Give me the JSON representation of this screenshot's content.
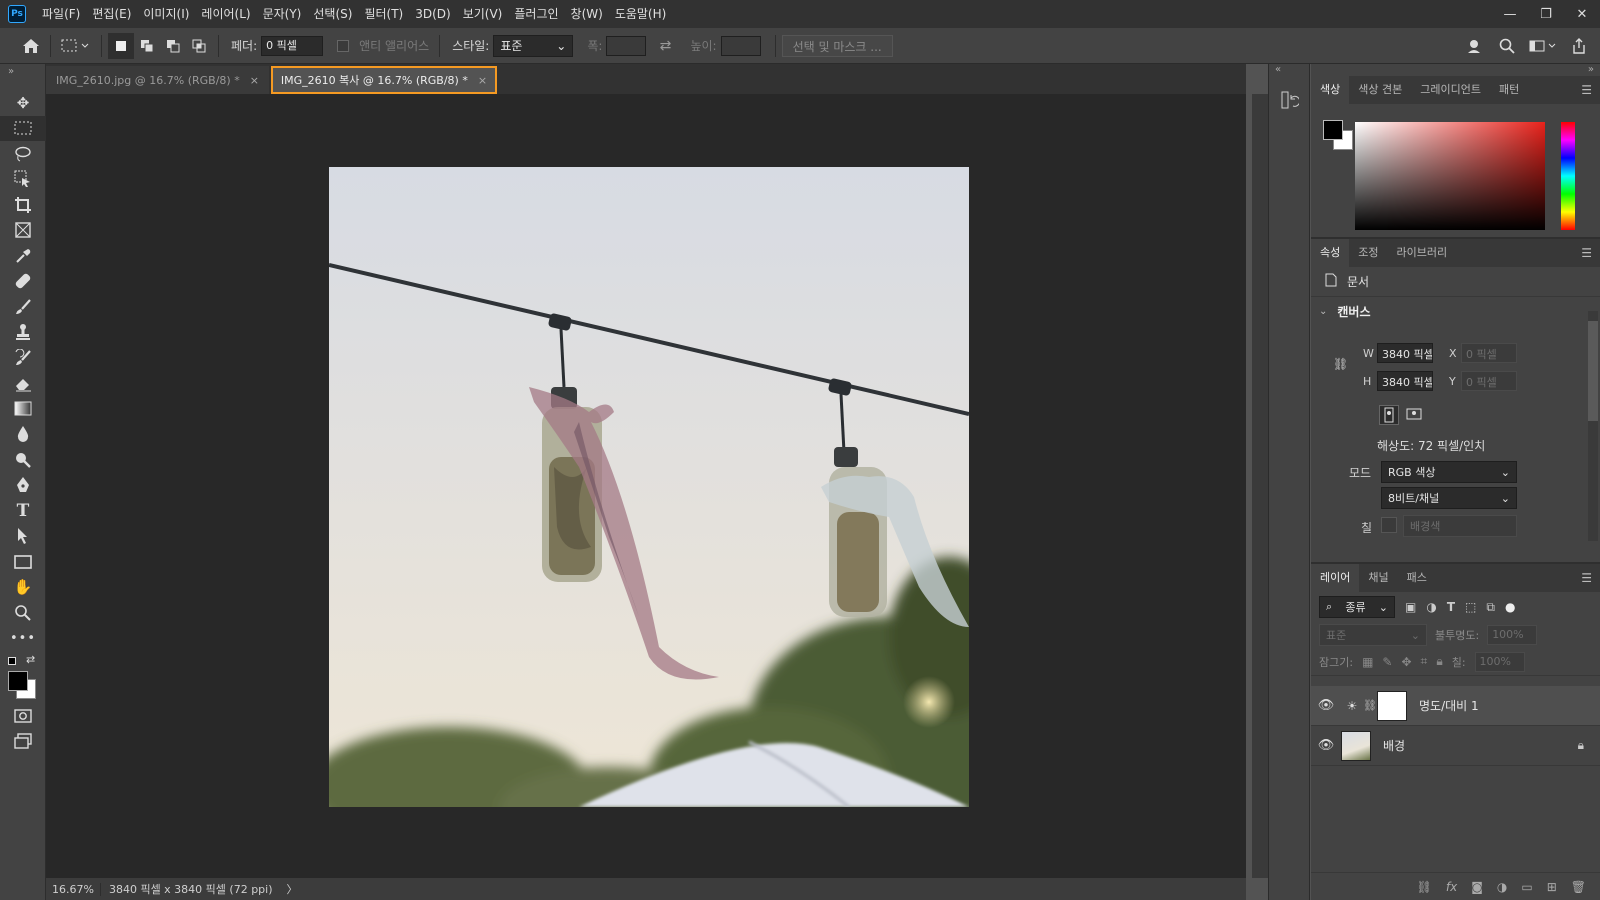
{
  "menubar": {
    "logo": "Ps",
    "items": [
      "파일(F)",
      "편집(E)",
      "이미지(I)",
      "레이어(L)",
      "문자(Y)",
      "선택(S)",
      "필터(T)",
      "3D(D)",
      "보기(V)",
      "플러그인",
      "창(W)",
      "도움말(H)"
    ],
    "window_controls": [
      "—",
      "❐",
      "✕"
    ]
  },
  "options": {
    "feather_label": "페더:",
    "feather_value": "0 픽셀",
    "antialias_label": "앤티 앨리어스",
    "style_label": "스타일:",
    "style_value": "표준",
    "width_label": "폭:",
    "height_label": "높이:",
    "select_mask_label": "선택 및 마스크 ..."
  },
  "tools": [
    "move-tool",
    "marquee-tool",
    "lasso-tool",
    "object-select-tool",
    "crop-tool",
    "frame-tool",
    "eyedropper-tool",
    "healing-tool",
    "brush-tool",
    "stamp-tool",
    "history-brush-tool",
    "eraser-tool",
    "gradient-tool",
    "blur-tool",
    "dodge-tool",
    "pen-tool",
    "type-tool",
    "path-select-tool",
    "rectangle-tool",
    "hand-tool",
    "zoom-tool",
    "more-tools"
  ],
  "tabs": [
    {
      "label": "IMG_2610.jpg @ 16.7% (RGB/8) *",
      "close": "×"
    },
    {
      "label": "IMG_2610 복사 @ 16.7% (RGB/8) *",
      "close": "×"
    }
  ],
  "status": {
    "zoom": "16.67%",
    "info": "3840 픽셀 x 3840 픽셀 (72 ppi)",
    "arrow": "〉"
  },
  "color_panel": {
    "tabs": [
      "색상",
      "색상 견본",
      "그레이디언트",
      "패턴"
    ]
  },
  "properties_panel": {
    "tabs": [
      "속성",
      "조정",
      "라이브러리"
    ],
    "doc_label": "문서",
    "canvas_section": "캔버스",
    "w_label": "W",
    "w_value": "3840 픽셀",
    "h_label": "H",
    "h_value": "3840 픽셀",
    "x_label": "X",
    "x_placeholder": "0 픽셀",
    "y_label": "Y",
    "y_placeholder": "0 픽셀",
    "resolution": "해상도: 72 픽셀/인치",
    "mode_label": "모드",
    "mode_value": "RGB 색상",
    "depth_value": "8비트/채널",
    "fill_label": "칠",
    "fill_value": "배경색"
  },
  "layers_panel": {
    "tabs": [
      "레이어",
      "채널",
      "패스"
    ],
    "filter_label": "종류",
    "blend_mode": "표준",
    "opacity_label": "불투명도:",
    "opacity_value": "100%",
    "lock_label": "잠그기:",
    "fill_label": "칠:",
    "fill_value": "100%",
    "layers": [
      {
        "name": "명도/대비 1",
        "type": "adjustment",
        "visible": true,
        "locked": false
      },
      {
        "name": "배경",
        "type": "image",
        "visible": true,
        "locked": true
      }
    ]
  },
  "colors": {
    "accent_highlight": "#f59a23",
    "foreground": "#000000",
    "background": "#ffffff"
  }
}
